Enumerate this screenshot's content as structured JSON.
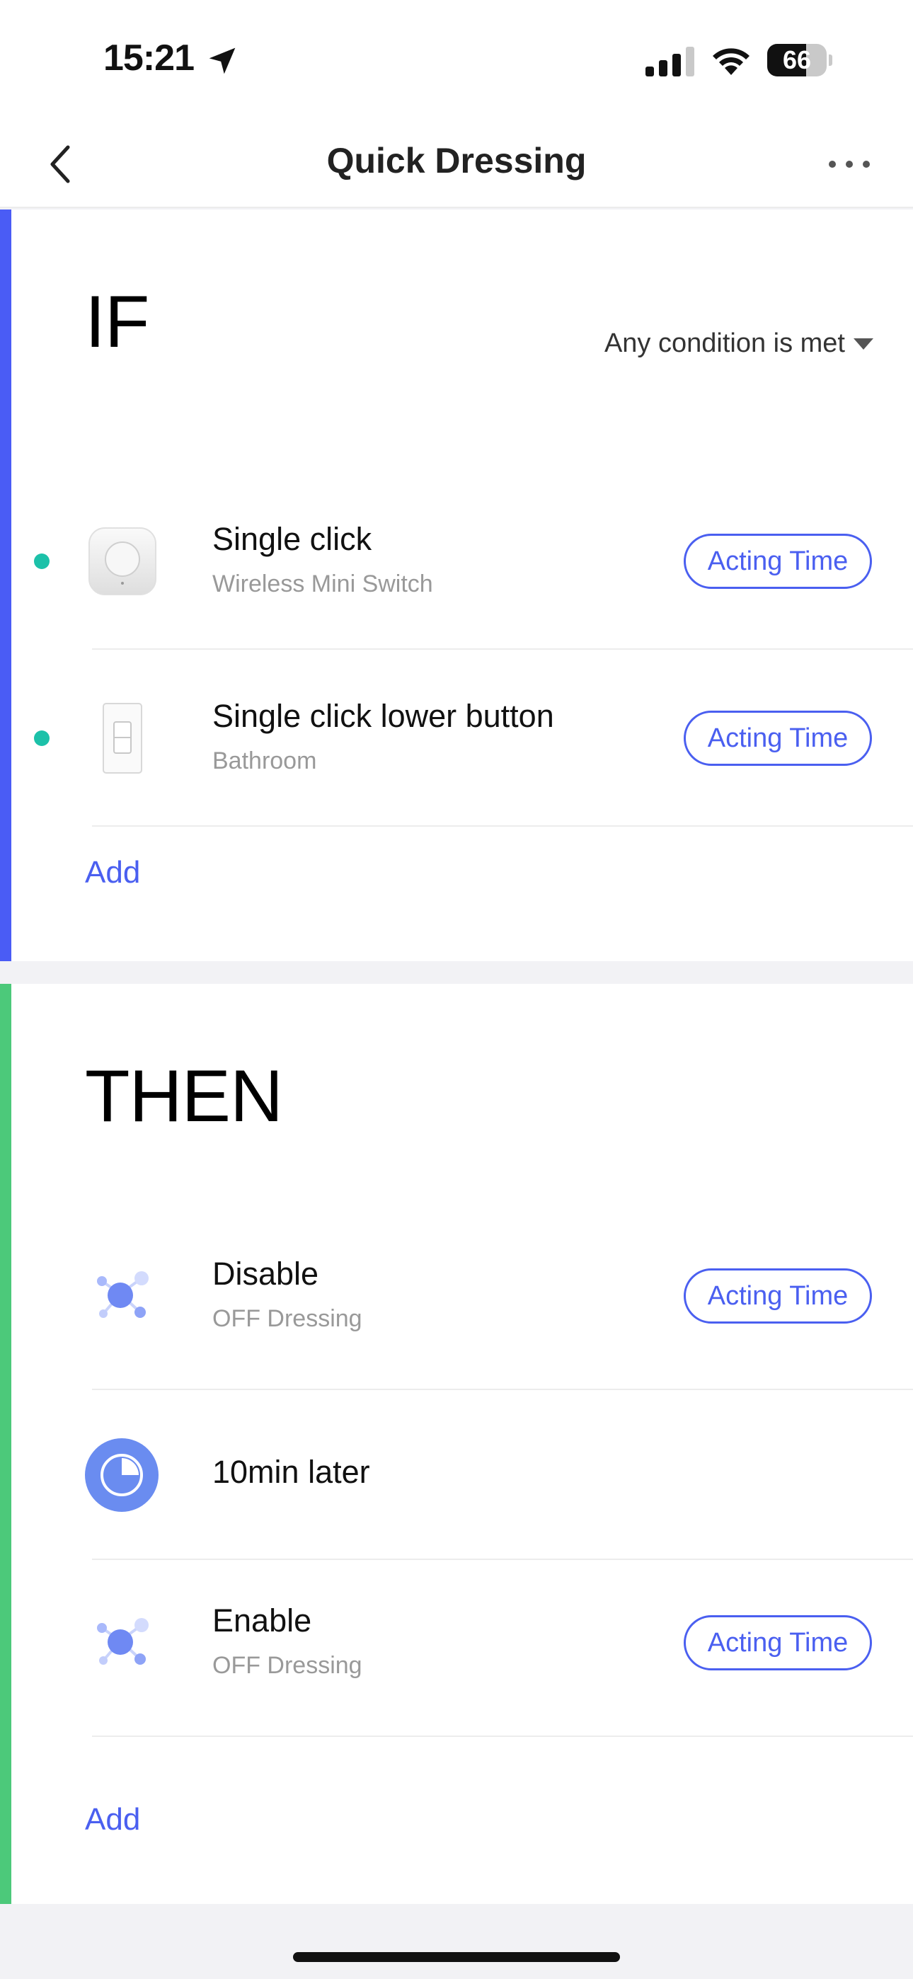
{
  "status_bar": {
    "time": "15:21",
    "battery_level": "66",
    "icons": [
      "location-arrow-icon",
      "cellular-signal-icon",
      "wifi-icon",
      "battery-icon"
    ]
  },
  "nav": {
    "title": "Quick Dressing",
    "back_icon": "chevron-left-icon",
    "more_icon": "ellipsis-icon"
  },
  "if_section": {
    "heading": "IF",
    "condition_mode": "Any condition is met",
    "accent_color": "#4a5cf5",
    "items": [
      {
        "title": "Single click",
        "subtitle": "Wireless Mini Switch",
        "action": "Acting Time",
        "icon": "mini-switch-icon"
      },
      {
        "title": "Single click lower button",
        "subtitle": "Bathroom",
        "action": "Acting Time",
        "icon": "wall-switch-icon"
      }
    ],
    "add_label": "Add"
  },
  "then_section": {
    "heading": "THEN",
    "accent_color": "#4cc97a",
    "items": [
      {
        "title": "Disable",
        "subtitle": "OFF Dressing",
        "action": "Acting Time",
        "icon": "automation-icon"
      },
      {
        "title": "10min later",
        "icon": "timer-icon"
      },
      {
        "title": "Enable",
        "subtitle": "OFF Dressing",
        "action": "Acting Time",
        "icon": "automation-icon"
      }
    ],
    "add_label": "Add"
  },
  "colors": {
    "link": "#4a5ff0",
    "status_dot": "#1cc1a9",
    "background": "#f2f2f5"
  }
}
